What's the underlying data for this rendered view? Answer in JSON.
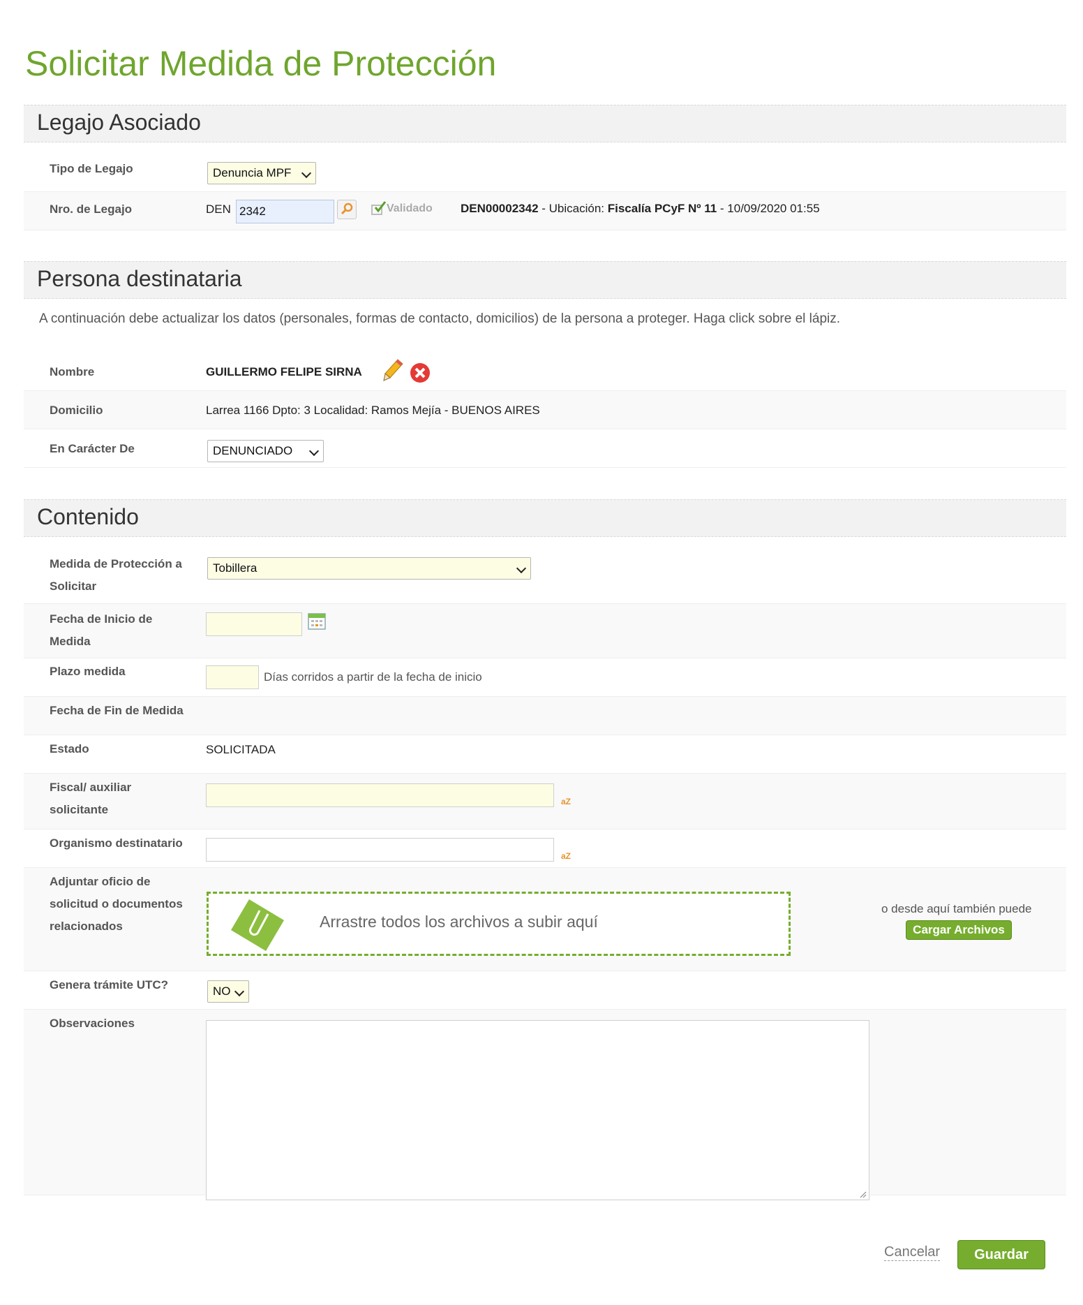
{
  "page": {
    "title": "Solicitar Medida de Protección"
  },
  "legajo": {
    "section_title": "Legajo Asociado",
    "tipo_label": "Tipo de Legajo",
    "tipo_value": "Denuncia MPF",
    "nro_label": "Nro. de Legajo",
    "nro_prefix": "DEN",
    "nro_value": "2342",
    "validado_label": "Validado",
    "info_code": "DEN00002342",
    "info_sep1": " - Ubicación: ",
    "info_ubicacion": "Fiscalía PCyF Nº 11",
    "info_sep2": " - ",
    "info_date": "10/09/2020 01:55"
  },
  "persona": {
    "section_title": "Persona destinataria",
    "instructions": "A continuación debe actualizar los datos (personales, formas de contacto, domicilios) de la persona a proteger. Haga click sobre el lápiz.",
    "nombre_label": "Nombre",
    "nombre_value": "GUILLERMO FELIPE SIRNA",
    "domicilio_label": "Domicilio",
    "domicilio_value": "Larrea 1166 Dpto: 3 Localidad: Ramos Mejía - BUENOS AIRES",
    "caracter_label": "En Carácter De",
    "caracter_value": "DENUNCIADO"
  },
  "contenido": {
    "section_title": "Contenido",
    "medida_label_1": "Medida de Protección a",
    "medida_label_2": "Solicitar",
    "medida_value": "Tobillera",
    "fecha_inicio_label_1": "Fecha de Inicio de",
    "fecha_inicio_label_2": "Medida",
    "fecha_inicio_value": "",
    "plazo_label": "Plazo medida",
    "plazo_value": "",
    "plazo_hint": "Días corridos a partir de la fecha de inicio",
    "fecha_fin_label": "Fecha de Fin de Medida",
    "estado_label": "Estado",
    "estado_value": "SOLICITADA",
    "fiscal_label_1": "Fiscal/ auxiliar",
    "fiscal_label_2": "solicitante",
    "fiscal_value": "",
    "organismo_label": "Organismo destinatario",
    "organismo_value": "",
    "az_text": "aZ",
    "adjuntar_label_1": "Adjuntar oficio de",
    "adjuntar_label_2": "solicitud o documentos",
    "adjuntar_label_3": "relacionados",
    "dropzone_text": "Arrastre todos los archivos a subir aquí",
    "upload_hint": "o desde aquí también puede",
    "upload_button": "Cargar Archivos",
    "utc_label": "Genera trámite UTC?",
    "utc_value": "NO",
    "observaciones_label": "Observaciones",
    "observaciones_value": ""
  },
  "actions": {
    "cancel": "Cancelar",
    "save": "Guardar"
  },
  "colors": {
    "accent": "#6fa52d",
    "button": "#76ad2e",
    "field_bg": "#fdfde4",
    "error": "#e53935"
  }
}
